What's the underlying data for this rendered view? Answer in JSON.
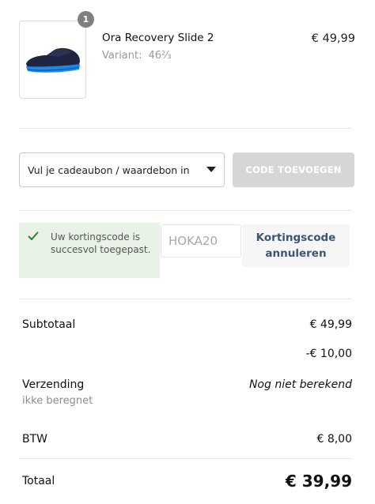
{
  "product": {
    "quantity": "1",
    "name": "Ora Recovery Slide 2",
    "variant_label": "Variant:",
    "variant_value": "46⅔",
    "price": "€ 49,99",
    "image_icon": "slide-sandal-icon"
  },
  "giftcard": {
    "select_text": "Vul je cadeaubon / waardebon in",
    "add_button": "CODE TOEVOEGEN"
  },
  "discount": {
    "success_message": "Uw kortingscode is succesvol toegepast.",
    "code_value": "HOKA20",
    "cancel_label": "Kortingscode annuleren"
  },
  "summary": {
    "subtotal_label": "Subtotaal",
    "subtotal_value": "€ 49,99",
    "discount_value": "-€ 10,00",
    "shipping_label": "Verzending",
    "shipping_sub": "ikke beregnet",
    "shipping_value": "Nog niet berekend",
    "tax_label": "BTW",
    "tax_value": "€ 8,00",
    "total_label": "Totaal",
    "total_value": "€ 39,99"
  },
  "colors": {
    "accent_link": "#3b5672",
    "success_bg": "#e9f2e7",
    "success_check": "#2e7d32",
    "disabled_button": "#d6d6d6"
  }
}
